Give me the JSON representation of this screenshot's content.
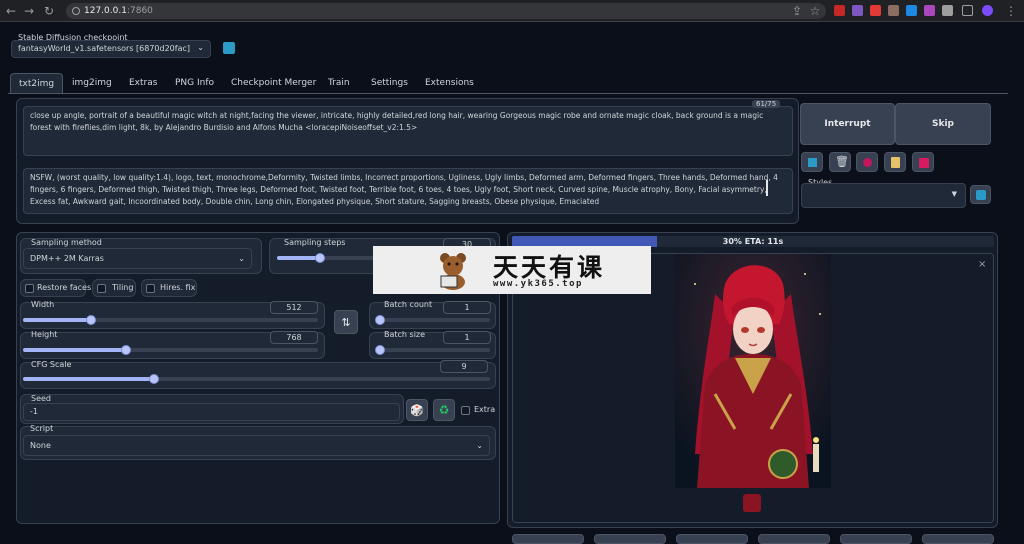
{
  "browser": {
    "url_host": "127.0.0.1",
    "url_port": ":7860"
  },
  "checkpoint": {
    "label": "Stable Diffusion checkpoint",
    "value": "fantasyWorld_v1.safetensors [6870d20fac]"
  },
  "tabs": [
    "txt2img",
    "img2img",
    "Extras",
    "PNG Info",
    "Checkpoint Merger",
    "Train",
    "Settings",
    "Extensions"
  ],
  "prompt": {
    "text": "close up angle, portrait of a beautiful magic witch at night,facing the viewer, intricate, highly detailed,red long hair, wearing Gorgeous magic robe and ornate magic cloak, back ground is a magic forest with fireflies,dim light, 8k, by Alejandro Burdisio and Alfons Mucha <loracepiNoiseoffset_v2:1.5>",
    "token_count": "61/75"
  },
  "negative_prompt": {
    "text": "NSFW, (worst quality, low quality:1.4), logo, text, monochrome,Deformity, Twisted limbs, Incorrect proportions, Ugliness, Ugly limbs, Deformed arm, Deformed fingers, Three hands, Deformed hand, 4 fingers, 6 fingers, Deformed thigh, Twisted thigh, Three legs, Deformed foot, Twisted foot, Terrible foot, 6 toes, 4 toes, Ugly foot, Short neck, Curved spine, Muscle atrophy, Bony, Facial asymmetry, Excess fat, Awkward gait, Incoordinated body, Double chin, Long chin, Elongated physique, Short stature, Sagging breasts, Obese physique, Emaciated"
  },
  "actions": {
    "interrupt": "Interrupt",
    "skip": "Skip",
    "styles_label": "Styles"
  },
  "settings": {
    "sampling_method_label": "Sampling method",
    "sampling_method": "DPM++ 2M Karras",
    "sampling_steps_label": "Sampling steps",
    "sampling_steps": "30",
    "sampling_steps_frac": 0.2,
    "restore_faces": "Restore faces",
    "tiling": "Tiling",
    "hires_fix": "Hires. fix",
    "width_label": "Width",
    "width": "512",
    "width_frac": 0.23,
    "height_label": "Height",
    "height": "768",
    "height_frac": 0.35,
    "batch_count_label": "Batch count",
    "batch_count": "1",
    "batch_size_label": "Batch size",
    "batch_size": "1",
    "cfg_label": "CFG Scale",
    "cfg": "9",
    "cfg_frac": 0.28,
    "seed_label": "Seed",
    "seed": "-1",
    "extra": "Extra",
    "script_label": "Script",
    "script": "None"
  },
  "progress": {
    "text": "30% ETA: 11s",
    "percent": 30
  },
  "watermark": {
    "title": "天天有课",
    "url": "www.yk365.top"
  },
  "colors": {
    "accent": "#a3b4f7",
    "progress": "#4258b6",
    "bg": "#0b0f19"
  }
}
